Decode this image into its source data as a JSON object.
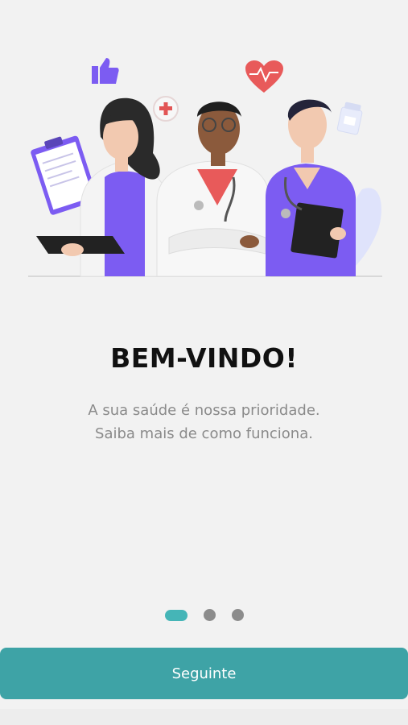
{
  "onboarding": {
    "title": "BEM-VINDO!",
    "subtitle_line1": "A sua saúde é nossa prioridade.",
    "subtitle_line2": "Saiba mais de como funciona.",
    "pages_total": 3,
    "current_page": 1,
    "next_button_label": "Seguinte"
  },
  "colors": {
    "accent": "#3ea3a6",
    "dot_active": "#45b5b7",
    "dot_inactive": "#8c8c8c",
    "purple": "#7c5cf2"
  },
  "icons": [
    "thumbs-up-icon",
    "plus-icon",
    "heart-pulse-icon",
    "medicine-bottle-icon",
    "clipboard-icon"
  ]
}
